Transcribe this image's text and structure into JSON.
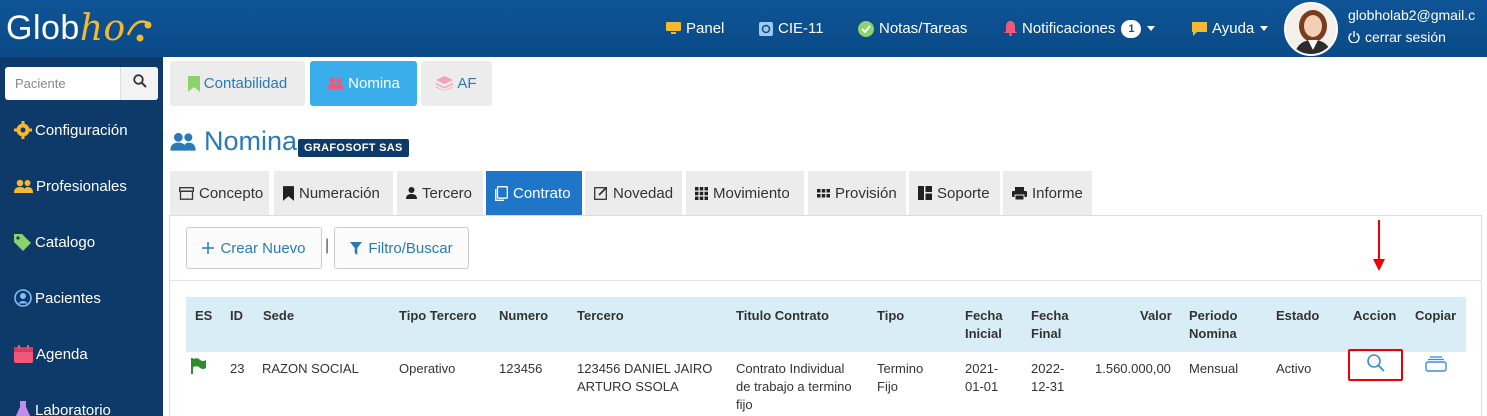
{
  "app": {
    "logo_text_a": "Glob",
    "logo_text_b": "ho"
  },
  "topnav": {
    "panel": "Panel",
    "cie": "CIE-11",
    "notas": "Notas/Tareas",
    "notificaciones": "Notificaciones",
    "notificaciones_count": "1",
    "ayuda": "Ayuda",
    "user_email": "globholab2@gmail.c",
    "logout": "cerrar sesión"
  },
  "sidebar": {
    "search_placeholder": "Paciente",
    "items": [
      {
        "label": "Configuración",
        "icon": "gear-icon"
      },
      {
        "label": "Profesionales",
        "icon": "users-icon"
      },
      {
        "label": "Catalogo",
        "icon": "tags-icon"
      },
      {
        "label": "Pacientes",
        "icon": "user-circle-icon"
      },
      {
        "label": "Agenda",
        "icon": "calendar-icon"
      },
      {
        "label": "Laboratorio",
        "icon": "flask-icon"
      }
    ]
  },
  "module_tabs": [
    {
      "label": "Contabilidad",
      "icon": "bookmark-icon",
      "active": false
    },
    {
      "label": "Nomina",
      "icon": "users-icon",
      "active": true
    },
    {
      "label": "AF",
      "icon": "layers-icon",
      "active": false
    }
  ],
  "page": {
    "title": "Nomina",
    "company": "GRAFOSOFT SAS"
  },
  "sub_tabs": [
    {
      "label": "Concepto",
      "icon": "box-icon"
    },
    {
      "label": "Numeración",
      "icon": "bookmark-icon"
    },
    {
      "label": "Tercero",
      "icon": "user-icon"
    },
    {
      "label": "Contrato",
      "icon": "copy-icon",
      "active": true
    },
    {
      "label": "Novedad",
      "icon": "edit-icon"
    },
    {
      "label": "Movimiento",
      "icon": "grid-icon"
    },
    {
      "label": "Provisión",
      "icon": "grid-small-icon"
    },
    {
      "label": "Soporte",
      "icon": "layout-icon"
    },
    {
      "label": "Informe",
      "icon": "print-icon"
    }
  ],
  "toolbar": {
    "crear": "Crear Nuevo",
    "filtro": "Filtro/Buscar",
    "separator": "|"
  },
  "table": {
    "headers": {
      "es": "ES",
      "id": "ID",
      "sede": "Sede",
      "tipo_tercero": "Tipo Tercero",
      "numero": "Numero",
      "tercero": "Tercero",
      "titulo": "Titulo Contrato",
      "tipo": "Tipo",
      "fecha_inicial_1": "Fecha",
      "fecha_inicial_2": "Inicial",
      "fecha_final_1": "Fecha",
      "fecha_final_2": "Final",
      "valor": "Valor",
      "periodo_1": "Periodo",
      "periodo_2": "Nomina",
      "estado": "Estado",
      "accion": "Accion",
      "copiar": "Copiar"
    },
    "row": {
      "id": "23",
      "sede": "RAZON SOCIAL",
      "tipo_tercero": "Operativo",
      "numero": "123456",
      "tercero_1": "123456 DANIEL JAIRO",
      "tercero_2": "ARTURO SSOLA",
      "titulo_1": "Contrato Individual",
      "titulo_2": "de trabajo a termino",
      "titulo_3": "fijo",
      "tipo_1": "Termino",
      "tipo_2": "Fijo",
      "fecha_inicial_1": "2021-",
      "fecha_inicial_2": "01-01",
      "fecha_final_1": "2022-",
      "fecha_final_2": "12-31",
      "valor": "1.560.000,00",
      "periodo": "Mensual",
      "estado": "Activo"
    }
  },
  "colors": {
    "topbar": "#0b4d8c",
    "sidebar": "#0d3a68",
    "accent": "#1f76c9",
    "highlight": "#e00000",
    "table_head": "#d9edf7"
  }
}
